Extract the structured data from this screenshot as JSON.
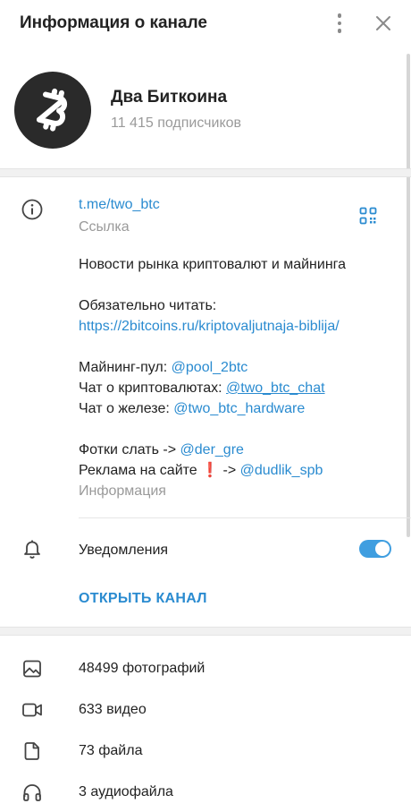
{
  "header": {
    "title": "Информация о канале"
  },
  "channel": {
    "name": "Два Биткоина",
    "subscribers": "11 415 подписчиков"
  },
  "info": {
    "link": "t.me/two_btc",
    "link_caption": "Ссылка",
    "desc_line1": "Новости рынка криптовалют и майнинга",
    "desc_line2": "Обязательно читать:",
    "desc_url": "https://2bitcoins.ru/kriptovaljutnaja-biblija/",
    "mining_label": "Майнинг-пул: ",
    "mining_link": "@pool_2btc",
    "crypto_chat_label": "Чат о криптовалютах: ",
    "crypto_chat_link": "@two_btc_chat",
    "hw_chat_label": "Чат о железе: ",
    "hw_chat_link": "@two_btc_hardware",
    "photos_label": "Фотки слать -> ",
    "photos_link": "@der_gre",
    "ads_label": "Реклама на сайте",
    "ads_emoji": "❗",
    "ads_arrow": " -> ",
    "ads_link": "@dudlik_spb",
    "caption": "Информация"
  },
  "notifications": {
    "label": "Уведомления",
    "enabled": true
  },
  "open_channel": {
    "label": "ОТКРЫТЬ КАНАЛ"
  },
  "media": [
    {
      "label": "48499 фотографий",
      "icon": "photo-icon"
    },
    {
      "label": "633 видео",
      "icon": "video-icon"
    },
    {
      "label": "73 файла",
      "icon": "file-icon"
    },
    {
      "label": "3 аудиофайла",
      "icon": "headphones-icon"
    }
  ],
  "colors": {
    "accent": "#2a8bd0",
    "toggle_on": "#3f9ee0",
    "muted": "#9a9a9a"
  }
}
